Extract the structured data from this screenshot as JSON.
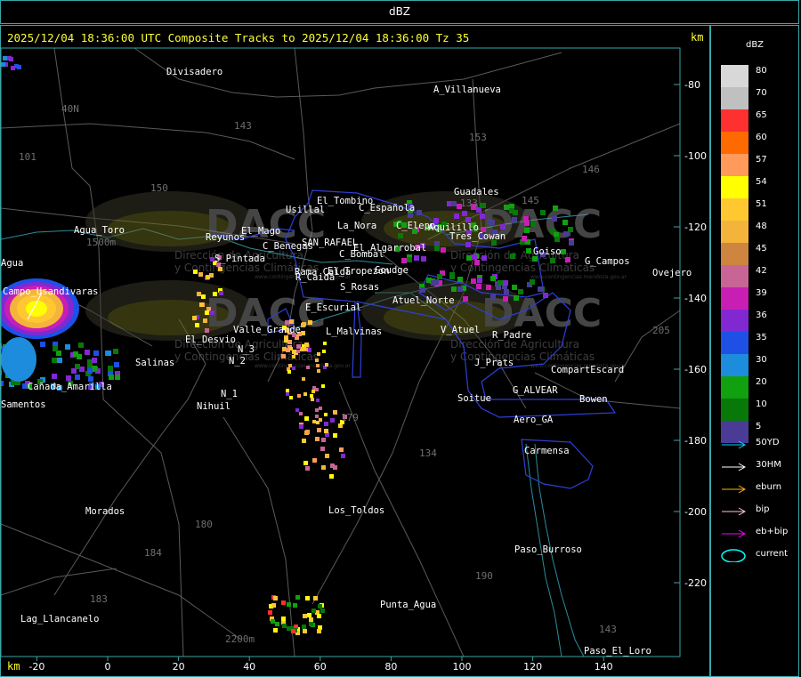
{
  "window": {
    "title": "dBZ"
  },
  "map": {
    "header": "2025/12/04 18:36:00 UTC Composite Tracks to 2025/12/04 18:36:00 Tz 35",
    "km_label_top": "km",
    "km_label_bottom": "km",
    "y_ticks": [
      "-80",
      "-100",
      "-120",
      "-140",
      "-160",
      "-180",
      "-200",
      "-220"
    ],
    "x_ticks": [
      "-20",
      "0",
      "20",
      "40",
      "60",
      "80",
      "100",
      "120",
      "140"
    ],
    "places": [
      "Divisadero",
      "A_Villanueva",
      "Guadales",
      "El_Tombino",
      "Usillal",
      "C_Española",
      "La_Nora",
      "C_Elepo",
      "Aquilillo",
      "Tres_Cowan",
      "Goiso",
      "G_Campos",
      "Ovejero",
      "Agua_Toro",
      "Reyunos",
      "El_Mago",
      "C_Benegas",
      "SAN_RAFAEL",
      "El_Algarrobal",
      "C_Bombal",
      "El_Tropezon",
      "Goudge",
      "Agua",
      "Campo_Usandivaras",
      "S_Pintada",
      "R_Caida",
      "S_Rosas",
      "E_Escurial",
      "Atuel_Norte",
      "Valle_Grande",
      "L_Malvinas",
      "V_Atuel",
      "R_Padre",
      "El_Desvio",
      "N_2",
      "N_3",
      "Salinas",
      "J_Prats",
      "CompartEscard",
      "G_ALVEAR",
      "Soitue",
      "Bowen",
      "Aero_GA",
      "Carmensa",
      "Cañada_Amarilla",
      "N_1",
      "Nihuil",
      "Samentos",
      "Morados",
      "Los_Toldos",
      "Paso_Burroso",
      "Punta_Agua",
      "Lag_Llancanelo",
      "Paso_El_Loro",
      "1500m",
      "2200m",
      "Rama Caída",
      "40N",
      "101",
      "143",
      "153",
      "150",
      "146",
      "145",
      "134",
      "180",
      "184",
      "133",
      "179",
      "190",
      "183",
      "205",
      "143 "
    ],
    "watermark": {
      "brand": "DACC",
      "subtitle_1": "Dirección de Agricultura",
      "subtitle_2": "y Contingencias Climáticas",
      "url": "www.contingencias.mendoza.gov.ar"
    }
  },
  "legend": {
    "title": "dBZ",
    "levels": [
      {
        "label": "80",
        "color": "#d8d8d8"
      },
      {
        "label": "70",
        "color": "#c0c0c0"
      },
      {
        "label": "65",
        "color": "#ff3030"
      },
      {
        "label": "60",
        "color": "#ff6a00"
      },
      {
        "label": "57",
        "color": "#ff9a5a"
      },
      {
        "label": "54",
        "color": "#ffff00"
      },
      {
        "label": "51",
        "color": "#ffc830"
      },
      {
        "label": "48",
        "color": "#f4b43c"
      },
      {
        "label": "45",
        "color": "#cd853f"
      },
      {
        "label": "42",
        "color": "#c86496"
      },
      {
        "label": "39",
        "color": "#c81eb4"
      },
      {
        "label": "36",
        "color": "#8228d2"
      },
      {
        "label": "35",
        "color": "#1e50e6"
      },
      {
        "label": "30",
        "color": "#1e8cdc"
      },
      {
        "label": "20",
        "color": "#10a010"
      },
      {
        "label": "10",
        "color": "#087808"
      },
      {
        "label": "5",
        "color": "#4a3c96"
      }
    ],
    "tracks": [
      {
        "label": "50YD",
        "color": "#00d8ff"
      },
      {
        "label": "30HM",
        "color": "#ffffff"
      },
      {
        "label": "eburn",
        "color": "#ffb400"
      },
      {
        "label": "bip",
        "color": "#ffc8c8"
      },
      {
        "label": "eb+bip",
        "color": "#ff00ff"
      },
      {
        "label": "current",
        "color": "#00ffff"
      }
    ]
  }
}
